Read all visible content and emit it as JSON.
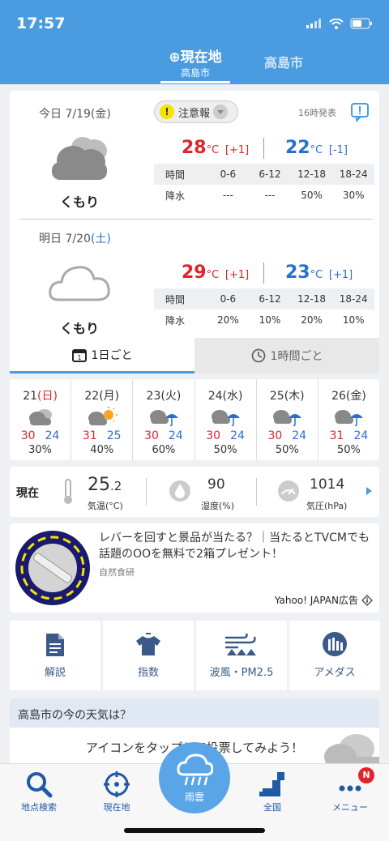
{
  "status": {
    "time": "17:57"
  },
  "header": {
    "tab_current_label": "現在地",
    "tab_current_sub": "高島市",
    "tab_other": "高島市"
  },
  "today": {
    "date_prefix": "今日",
    "date": "7/19",
    "weekday": "(金)",
    "warning": "注意報",
    "published": "16時発表",
    "weather": "くもり",
    "high": "28",
    "high_diff": "[+1]",
    "low": "22",
    "low_diff": "[-1]",
    "unit": "°C",
    "precip_header": [
      "時間",
      "0-6",
      "6-12",
      "12-18",
      "18-24"
    ],
    "precip": [
      "降水",
      "---",
      "---",
      "50%",
      "30%"
    ]
  },
  "tomorrow": {
    "date_prefix": "明日",
    "date": "7/20",
    "weekday": "(土)",
    "weather": "くもり",
    "high": "29",
    "high_diff": "[+1]",
    "low": "23",
    "low_diff": "[+1]",
    "unit": "°C",
    "precip_header": [
      "時間",
      "0-6",
      "6-12",
      "12-18",
      "18-24"
    ],
    "precip": [
      "降水",
      "20%",
      "10%",
      "20%",
      "10%"
    ]
  },
  "forecast_tabs": {
    "daily": "1日ごと",
    "hourly": "1時間ごと"
  },
  "week": [
    {
      "day": "21",
      "wd": "(日)",
      "wd_color": "#e0242c",
      "icon": "cloud-icon",
      "hi": "30",
      "lo": "24",
      "pop": "30%"
    },
    {
      "day": "22",
      "wd": "(月)",
      "wd_color": "#333333",
      "icon": "cloud-sun-icon",
      "hi": "31",
      "lo": "25",
      "pop": "40%"
    },
    {
      "day": "23",
      "wd": "(火)",
      "wd_color": "#333333",
      "icon": "cloud-umbrella-icon",
      "hi": "30",
      "lo": "24",
      "pop": "60%"
    },
    {
      "day": "24",
      "wd": "(水)",
      "wd_color": "#333333",
      "icon": "cloud-umbrella-icon",
      "hi": "30",
      "lo": "24",
      "pop": "50%"
    },
    {
      "day": "25",
      "wd": "(木)",
      "wd_color": "#333333",
      "icon": "cloud-umbrella-icon",
      "hi": "30",
      "lo": "24",
      "pop": "50%"
    },
    {
      "day": "26",
      "wd": "(金)",
      "wd_color": "#333333",
      "icon": "cloud-umbrella-icon",
      "hi": "31",
      "lo": "24",
      "pop": "50%"
    }
  ],
  "now": {
    "label": "現在",
    "temp_int": "25",
    "temp_dec": ".2",
    "temp_label": "気温(°C)",
    "humidity": "90",
    "humidity_label": "湿度(%)",
    "pressure": "1014",
    "pressure_label": "気圧(hPa)"
  },
  "ad": {
    "text": "レバーを回すと景品が当たる？｜当たるとTVCMでも話題のOOを無料で2箱プレゼント！",
    "sponsor": "自然食研",
    "badge": "Yahoo! JAPAN広告"
  },
  "tools": [
    "解説",
    "指数",
    "波風・PM2.5",
    "アメダス"
  ],
  "vote": {
    "heading": "高島市の今の天気は？",
    "prompt": "アイコンをタップして投票してみよう！"
  },
  "nav": {
    "search": "地点検索",
    "current": "現在地",
    "rain": "雨雲",
    "national": "全国",
    "menu": "メニュー",
    "menu_badge": "N"
  }
}
